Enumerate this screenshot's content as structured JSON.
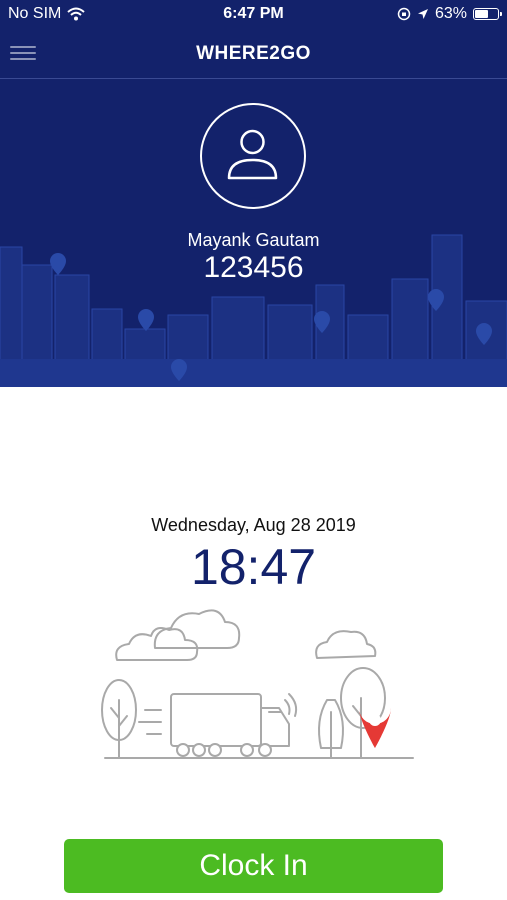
{
  "status_bar": {
    "carrier": "No SIM",
    "time": "6:47 PM",
    "battery_percent": "63%",
    "battery_level": 0.63
  },
  "nav": {
    "title": "WHERE2GO"
  },
  "profile": {
    "name": "Mayank Gautam",
    "id": "123456"
  },
  "main": {
    "date": "Wednesday, Aug 28 2019",
    "time": "18:47"
  },
  "actions": {
    "clock_in_label": "Clock In"
  },
  "colors": {
    "brand_navy": "#13226b",
    "clock_in_green": "#4cbb22",
    "pin_red": "#e53935"
  }
}
